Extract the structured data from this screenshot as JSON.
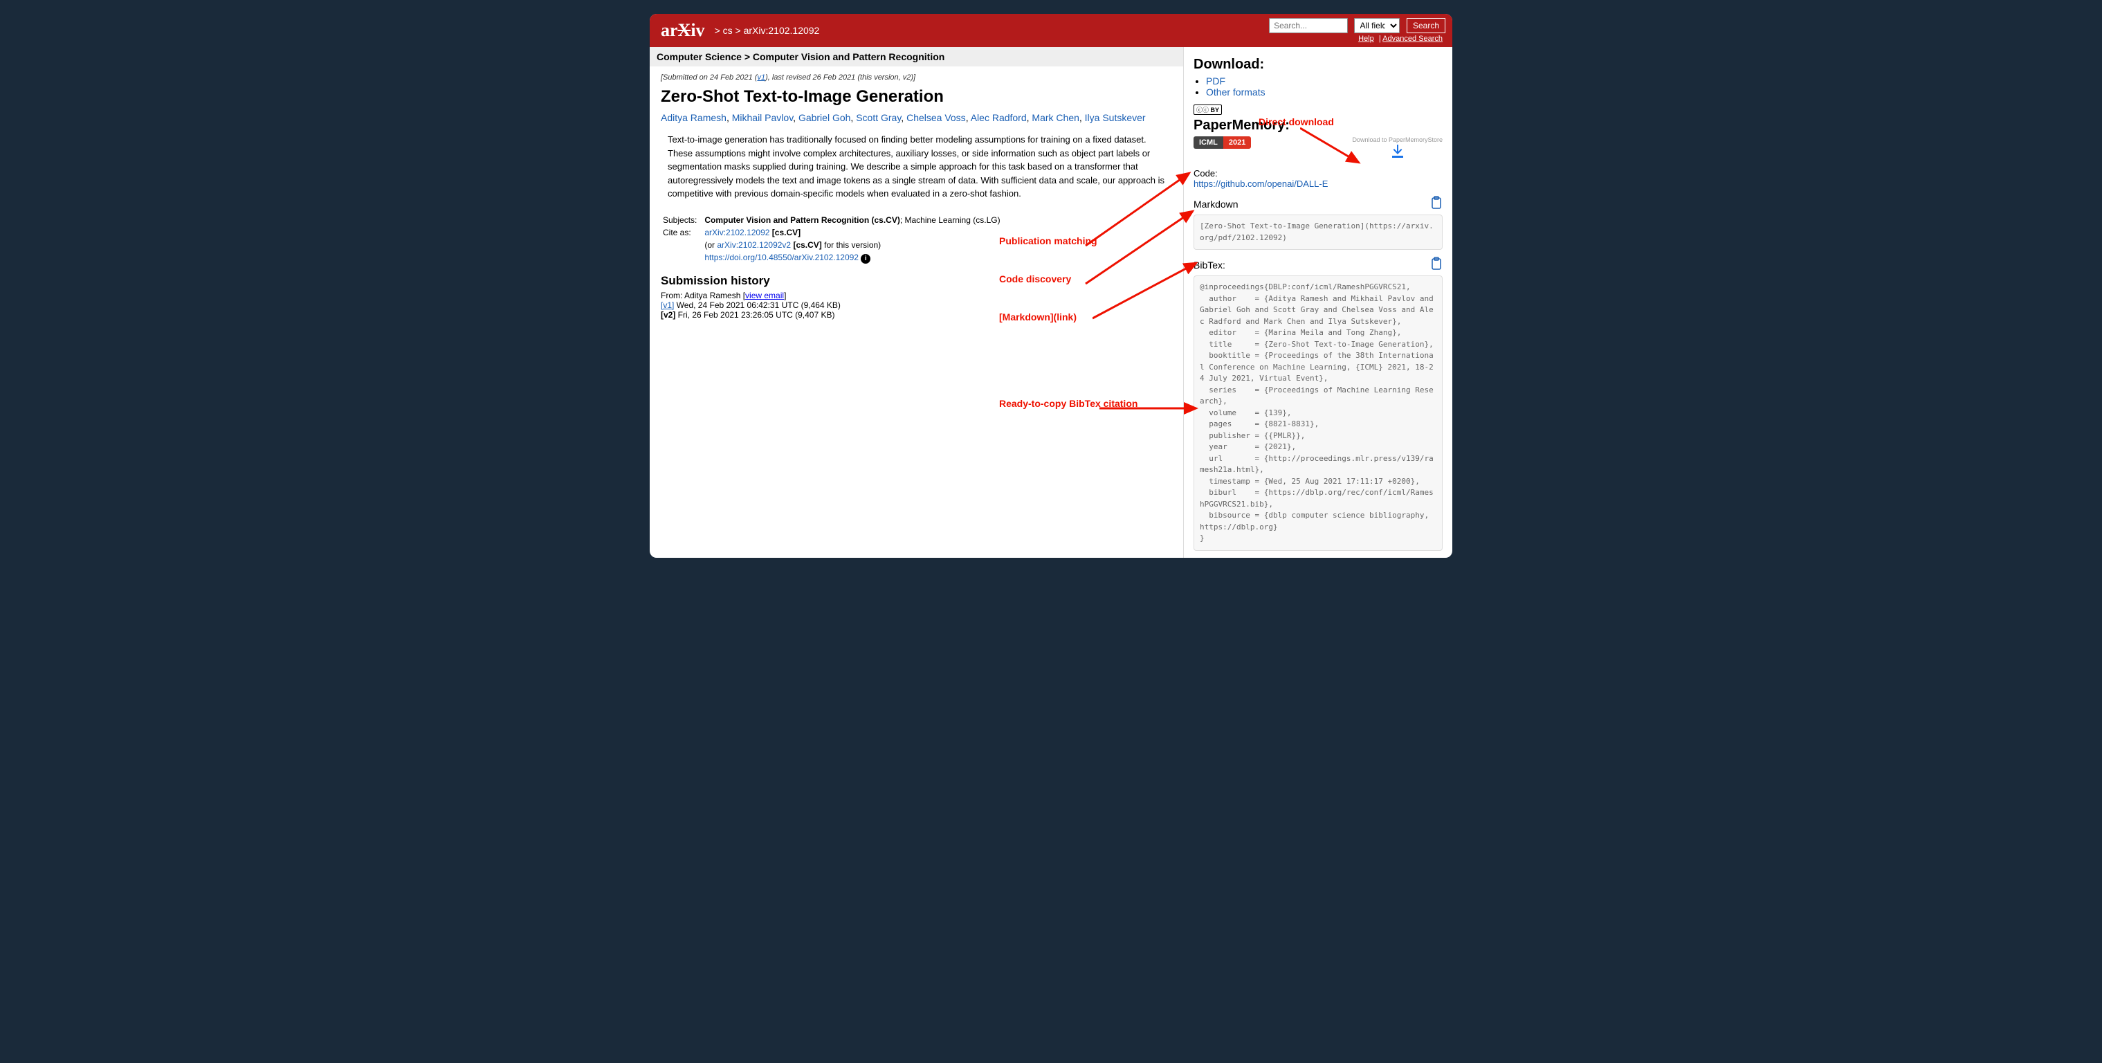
{
  "breadcrumb": {
    "site": "arXiv",
    "path": "> cs > arXiv:2102.12092"
  },
  "search": {
    "placeholder": "Search...",
    "field": "All fields",
    "button": "Search",
    "help": "Help",
    "adv": "Advanced Search"
  },
  "category": "Computer Science > Computer Vision and Pattern Recognition",
  "submitted": "[Submitted on 24 Feb 2021 (",
  "v1": "v1",
  "submitted2": "), last revised 26 Feb 2021 (this version, v2)]",
  "title": "Zero-Shot Text-to-Image Generation",
  "authors": [
    "Aditya Ramesh",
    "Mikhail Pavlov",
    "Gabriel Goh",
    "Scott Gray",
    "Chelsea Voss",
    "Alec Radford",
    "Mark Chen",
    "Ilya Sutskever"
  ],
  "abstract": "Text-to-image generation has traditionally focused on finding better modeling assumptions for training on a fixed dataset. These assumptions might involve complex architectures, auxiliary losses, or side information such as object part labels or segmentation masks supplied during training. We describe a simple approach for this task based on a transformer that autoregressively models the text and image tokens as a single stream of data. With sufficient data and scale, our approach is competitive with previous domain-specific models when evaluated in a zero-shot fashion.",
  "subjects_label": "Subjects:",
  "subjects_primary": "Computer Vision and Pattern Recognition (cs.CV)",
  "subjects_secondary": "; Machine Learning (cs.LG)",
  "cite_label": "Cite as:",
  "cite1": "arXiv:2102.12092",
  "cite1s": " [cs.CV]",
  "cite2_pre": "(or ",
  "cite2": "arXiv:2102.12092v2",
  "cite2s": " [cs.CV]",
  "cite2_post": " for this version)",
  "doi": "https://doi.org/10.48550/arXiv.2102.12092",
  "subhist": "Submission history",
  "from": "From: Aditya Ramesh [",
  "view_email": "view email",
  "from2": "]",
  "v1line": "[v1]",
  "v1rest": " Wed, 24 Feb 2021 06:42:31 UTC (9,464 KB)",
  "v2line": "[v2]",
  "v2rest": " Fri, 26 Feb 2021 23:26:05 UTC (9,407 KB)",
  "download": {
    "heading": "Download:",
    "pdf": "PDF",
    "other": "Other formats"
  },
  "pm": {
    "heading": "PaperMemory:",
    "venue": "ICML",
    "year": "2021",
    "dl_label": "Download to PaperMemoryStore",
    "code_label": "Code:",
    "code_url": "https://github.com/openai/DALL-E",
    "md_label": "Markdown",
    "md": "[Zero-Shot Text-to-Image Generation](https://arxiv.org/pdf/2102.12092)",
    "bib_label": "BibTex:",
    "bib": "@inproceedings{DBLP:conf/icml/RameshPGGVRCS21,\n  author    = {Aditya Ramesh and Mikhail Pavlov and Gabriel Goh and Scott Gray and Chelsea Voss and Alec Radford and Mark Chen and Ilya Sutskever},\n  editor    = {Marina Meila and Tong Zhang},\n  title     = {Zero-Shot Text-to-Image Generation},\n  booktitle = {Proceedings of the 38th International Conference on Machine Learning, {ICML} 2021, 18-24 July 2021, Virtual Event},\n  series    = {Proceedings of Machine Learning Research},\n  volume    = {139},\n  pages     = {8821-8831},\n  publisher = {{PMLR}},\n  year      = {2021},\n  url       = {http://proceedings.mlr.press/v139/ramesh21a.html},\n  timestamp = {Wed, 25 Aug 2021 17:11:17 +0200},\n  biburl    = {https://dblp.org/rec/conf/icml/RameshPGGVRCS21.bib},\n  bibsource = {dblp computer science bibliography, https://dblp.org}\n}"
  },
  "annotations": {
    "pub": "Publication matching",
    "code": "Code discovery",
    "md": "[Markdown](link)",
    "bib": "Ready-to-copy BibTex citation",
    "dl": "Direct download"
  }
}
